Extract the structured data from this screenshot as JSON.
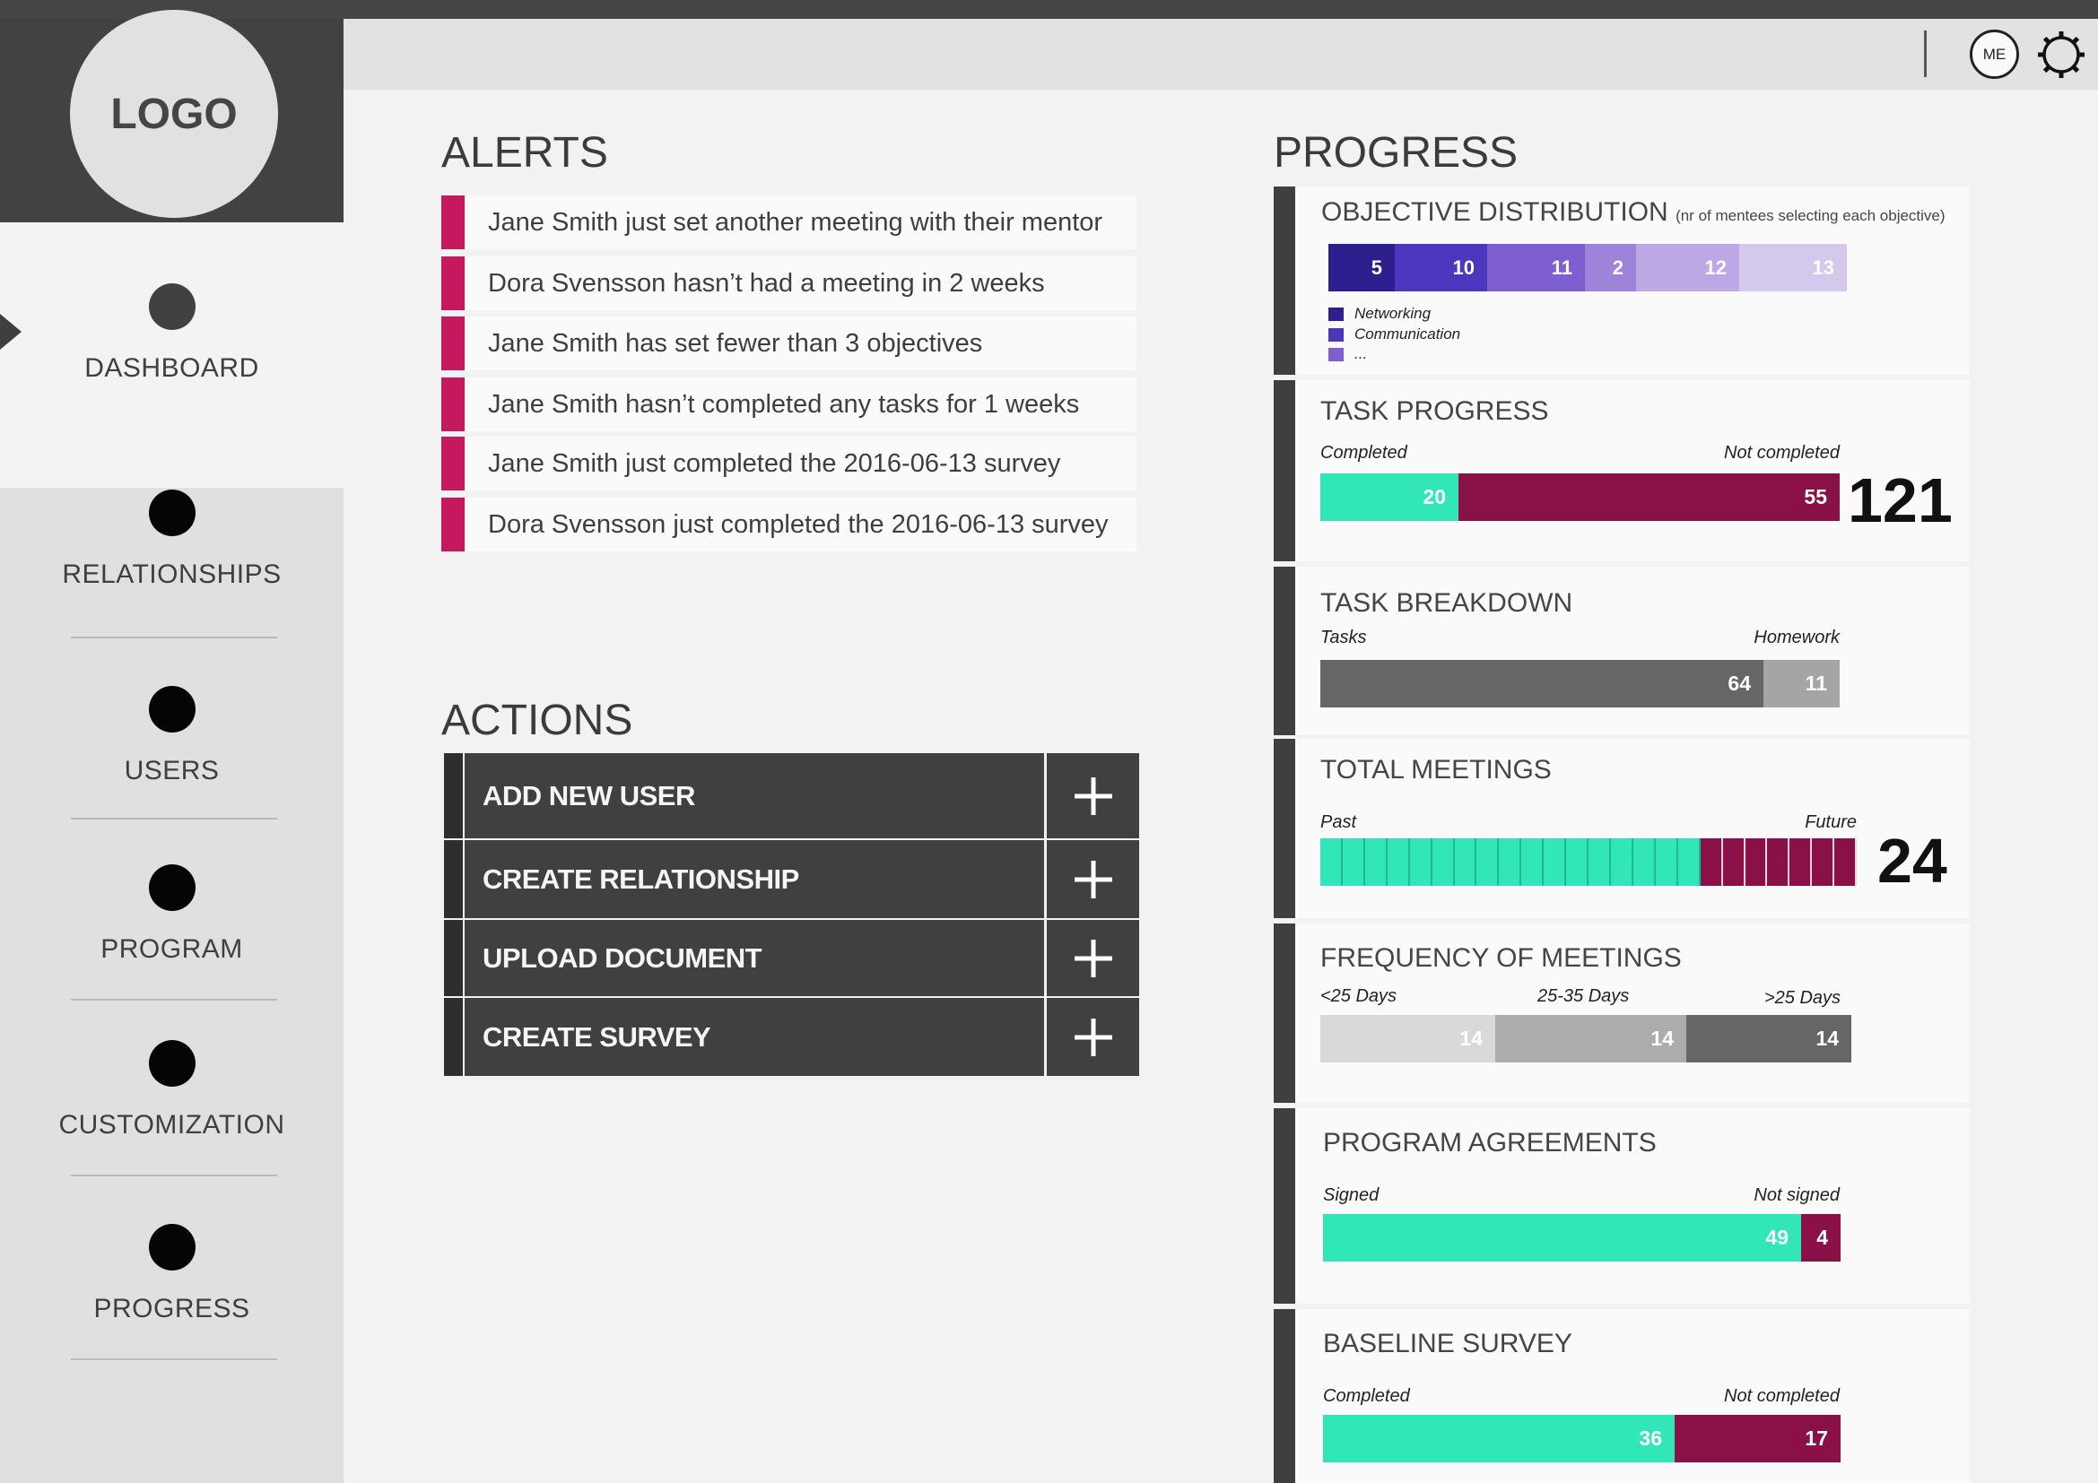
{
  "app": {
    "logo_text": "LOGO",
    "user_badge": "ME"
  },
  "sidebar": {
    "items": [
      {
        "label": "DASHBOARD",
        "active": true
      },
      {
        "label": "RELATIONSHIPS"
      },
      {
        "label": "USERS"
      },
      {
        "label": "PROGRAM"
      },
      {
        "label": "CUSTOMIZATION"
      },
      {
        "label": "PROGRESS"
      }
    ]
  },
  "alerts": {
    "title": "ALERTS",
    "items": [
      "Jane Smith just set another meeting with their mentor",
      "Dora Svensson hasn’t had a meeting in 2 weeks",
      "Jane Smith has set fewer than 3 objectives",
      "Jane Smith hasn’t completed any tasks for 1 weeks",
      "Jane Smith just completed the 2016-06-13 survey",
      "Dora Svensson just completed the 2016-06-13 survey"
    ]
  },
  "actions": {
    "title": "ACTIONS",
    "items": [
      "ADD NEW USER",
      "CREATE RELATIONSHIP",
      "UPLOAD DOCUMENT",
      "CREATE SURVEY"
    ]
  },
  "progress": {
    "title": "PROGRESS",
    "objective_distribution": {
      "title": "OBJECTIVE DISTRIBUTION",
      "subtitle": "(nr of mentees selecting each objective)",
      "values": [
        5,
        10,
        11,
        2,
        12,
        13
      ],
      "colors": [
        "#2e1f8f",
        "#4b36bd",
        "#7e5fcf",
        "#9d84d8",
        "#bca8e4",
        "#d4c9ec"
      ],
      "legend": [
        "Networking",
        "Communication",
        "..."
      ]
    },
    "task_progress": {
      "title": "TASK PROGRESS",
      "left_label": "Completed",
      "right_label": "Not completed",
      "completed": 20,
      "not_completed": 55,
      "total": "121"
    },
    "task_breakdown": {
      "title": "TASK BREAKDOWN",
      "left_label": "Tasks",
      "right_label": "Homework",
      "tasks": 64,
      "homework": 11
    },
    "total_meetings": {
      "title": "TOTAL MEETINGS",
      "left_label": "Past",
      "right_label": "Future",
      "past": 17,
      "future": 7,
      "total": "24"
    },
    "frequency_of_meetings": {
      "title": "FREQUENCY OF MEETINGS",
      "labels": [
        "<25 Days",
        "25-35 Days",
        ">25 Days"
      ],
      "values": [
        14,
        14,
        14
      ]
    },
    "program_agreements": {
      "title": "PROGRAM AGREEMENTS",
      "left_label": "Signed",
      "right_label": "Not signed",
      "signed": 49,
      "not_signed": 4
    },
    "baseline_survey": {
      "title": "BASELINE SURVEY",
      "left_label": "Completed",
      "right_label": "Not completed",
      "completed": 36,
      "not_completed": 17
    }
  },
  "colors": {
    "teal": "#31e6b7",
    "maroon": "#8a1048",
    "alert_red": "#c5195d",
    "dark": "#404040"
  }
}
